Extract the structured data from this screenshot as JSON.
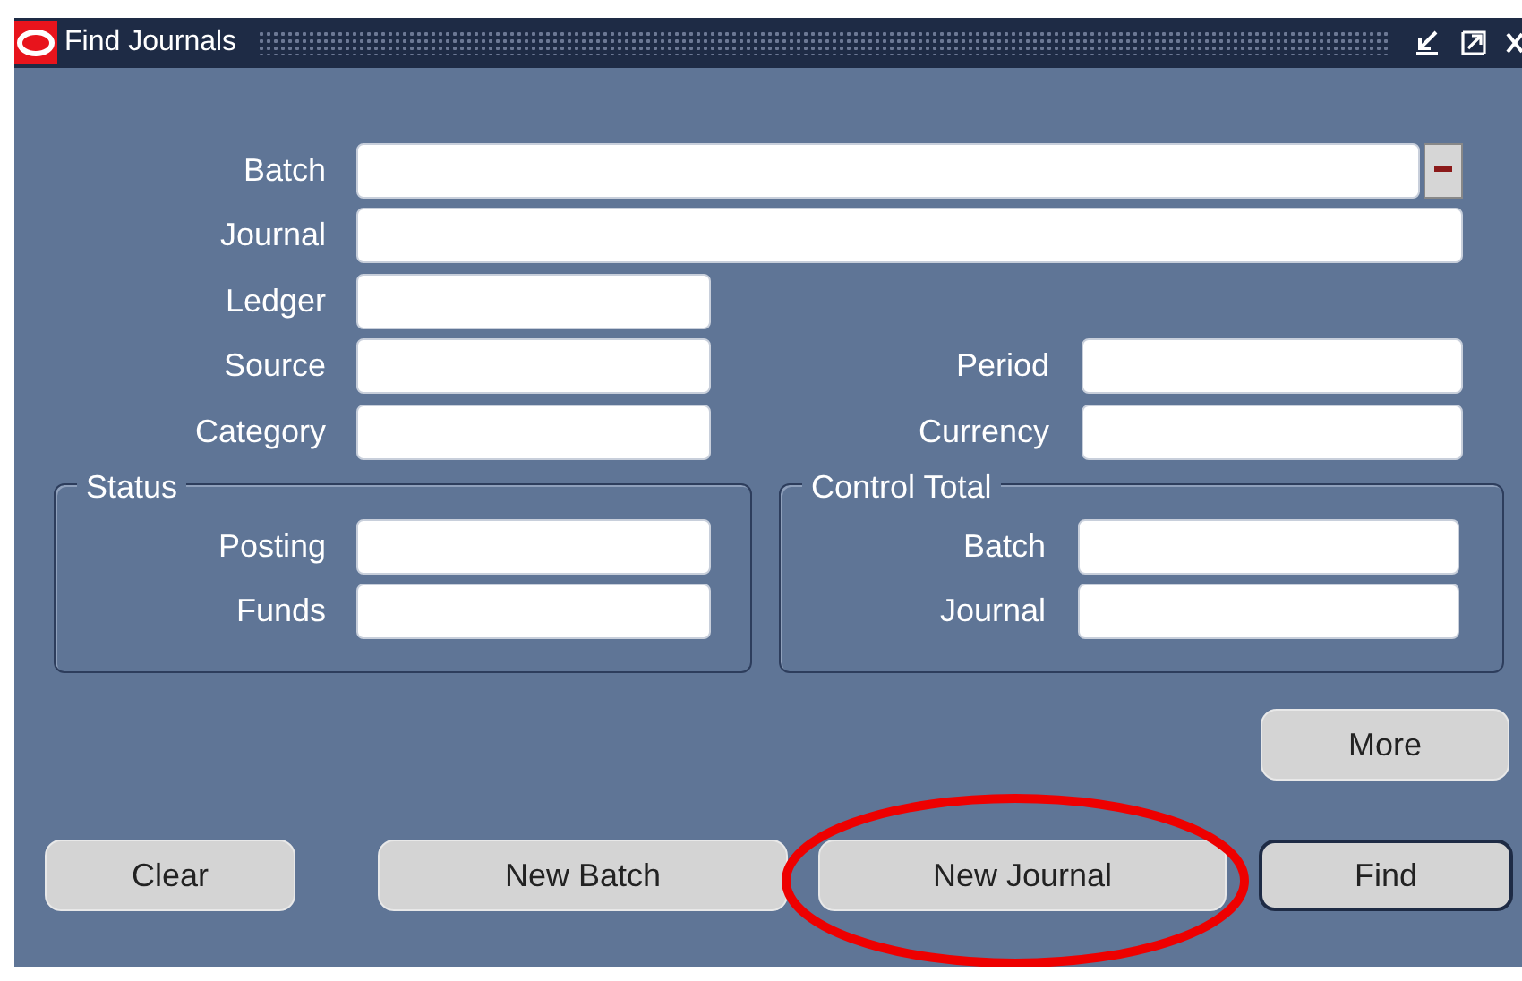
{
  "window": {
    "title": "Find Journals"
  },
  "rows": [
    {
      "fields": [
        {
          "label": "Batch",
          "kind": "lov"
        }
      ]
    },
    {
      "fields": [
        {
          "label": "Journal",
          "kind": "wide"
        }
      ]
    },
    {
      "fields": [
        {
          "label": "Ledger",
          "kind": "short"
        }
      ]
    },
    {
      "fields": [
        {
          "label": "Source",
          "kind": "short"
        },
        {
          "label": "Period",
          "kind": "short"
        }
      ]
    },
    {
      "fields": [
        {
          "label": "Category",
          "kind": "short"
        },
        {
          "label": "Currency",
          "kind": "short"
        }
      ]
    }
  ],
  "groups": [
    {
      "title": "Status",
      "fields": [
        {
          "label": "Posting"
        },
        {
          "label": "Funds"
        }
      ]
    },
    {
      "title": "Control Total",
      "fields": [
        {
          "label": "Batch"
        },
        {
          "label": "Journal"
        }
      ]
    }
  ],
  "more_button": {
    "label": "More"
  },
  "buttons": [
    {
      "label": "Clear",
      "default": false,
      "highlighted": false
    },
    {
      "label": "New Batch",
      "default": false,
      "highlighted": false
    },
    {
      "label": "New Journal",
      "default": false,
      "highlighted": true
    },
    {
      "label": "Find",
      "default": true,
      "highlighted": false
    }
  ]
}
